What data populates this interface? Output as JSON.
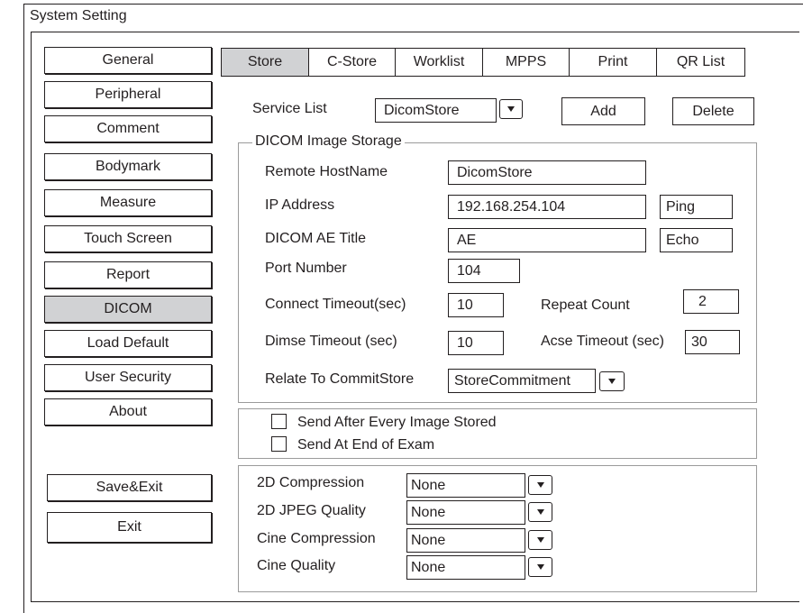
{
  "window": {
    "title": "System Setting"
  },
  "sidebar": {
    "items": [
      {
        "label": "General"
      },
      {
        "label": "Peripheral"
      },
      {
        "label": "Comment"
      },
      {
        "label": "Bodymark"
      },
      {
        "label": "Measure"
      },
      {
        "label": "Touch Screen"
      },
      {
        "label": "Report"
      },
      {
        "label": "DICOM"
      },
      {
        "label": "Load Default"
      },
      {
        "label": "User Security"
      },
      {
        "label": "About"
      }
    ],
    "active": "DICOM",
    "save_exit_label": "Save&Exit",
    "exit_label": "Exit"
  },
  "tabs": [
    {
      "label": "Store"
    },
    {
      "label": "C-Store"
    },
    {
      "label": "Worklist"
    },
    {
      "label": "MPPS"
    },
    {
      "label": "Print"
    },
    {
      "label": "QR List"
    }
  ],
  "active_tab": "Store",
  "service": {
    "label": "Service List",
    "value": "DicomStore",
    "add_label": "Add",
    "delete_label": "Delete"
  },
  "storage": {
    "group_title": "DICOM Image Storage",
    "remote_hostname_label": "Remote HostName",
    "remote_hostname_value": "DicomStore",
    "ip_label": "IP Address",
    "ip_value": "192.168.254.104",
    "ping_label": "Ping",
    "ae_title_label": "DICOM AE Title",
    "ae_title_value": "AE",
    "echo_label": "Echo",
    "port_label": "Port Number",
    "port_value": "104",
    "connect_timeout_label": "Connect Timeout(sec)",
    "connect_timeout_value": "10",
    "repeat_count_label": "Repeat Count",
    "repeat_count_value": "2",
    "dimse_timeout_label": "Dimse Timeout (sec)",
    "dimse_timeout_value": "10",
    "acse_timeout_label": "Acse Timeout (sec)",
    "acse_timeout_value": "30",
    "relate_label": "Relate To CommitStore",
    "relate_value": "StoreCommitment"
  },
  "send_options": {
    "after_every_label": "Send After Every Image Stored",
    "after_every_checked": false,
    "end_of_exam_label": "Send At End of Exam",
    "end_of_exam_checked": false
  },
  "compression": {
    "compression_2d_label": "2D Compression",
    "compression_2d_value": "None",
    "jpeg_quality_2d_label": "2D JPEG Quality",
    "jpeg_quality_2d_value": "None",
    "cine_compression_label": "Cine Compression",
    "cine_compression_value": "None",
    "cine_quality_label": "Cine Quality",
    "cine_quality_value": "None"
  }
}
